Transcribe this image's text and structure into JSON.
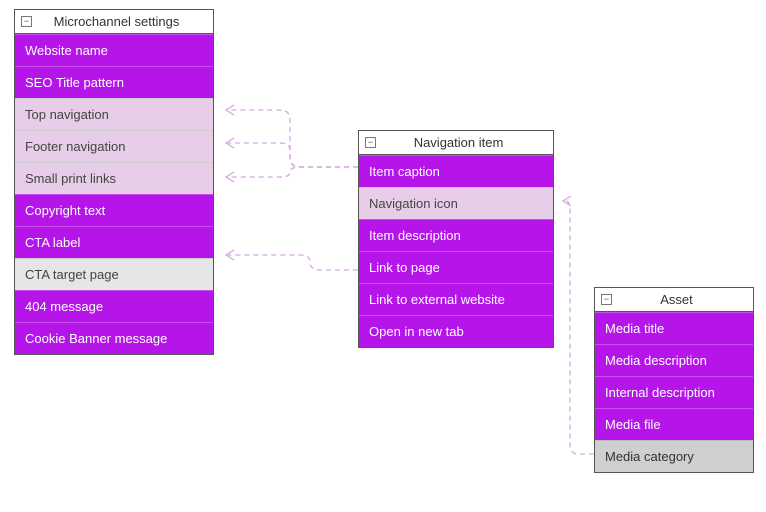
{
  "entities": {
    "microchannel": {
      "title": "Microchannel settings",
      "rows": [
        {
          "label": "Website name",
          "type": "normal"
        },
        {
          "label": "SEO Title pattern",
          "type": "normal"
        },
        {
          "label": "Top navigation",
          "type": "ref"
        },
        {
          "label": "Footer navigation",
          "type": "ref"
        },
        {
          "label": "Small print links",
          "type": "ref"
        },
        {
          "label": "Copyright text",
          "type": "normal"
        },
        {
          "label": "CTA label",
          "type": "normal"
        },
        {
          "label": "CTA target page",
          "type": "gray"
        },
        {
          "label": "404 message",
          "type": "normal"
        },
        {
          "label": "Cookie Banner message",
          "type": "normal"
        }
      ]
    },
    "navitem": {
      "title": "Navigation item",
      "rows": [
        {
          "label": "Item caption",
          "type": "normal"
        },
        {
          "label": "Navigation icon",
          "type": "ref"
        },
        {
          "label": "Item description",
          "type": "normal"
        },
        {
          "label": "Link to page",
          "type": "normal"
        },
        {
          "label": "Link to external website",
          "type": "normal"
        },
        {
          "label": "Open in new tab",
          "type": "normal"
        }
      ]
    },
    "asset": {
      "title": "Asset",
      "rows": [
        {
          "label": "Media title",
          "type": "normal"
        },
        {
          "label": "Media description",
          "type": "normal"
        },
        {
          "label": "Internal description",
          "type": "normal"
        },
        {
          "label": "Media file",
          "type": "normal"
        },
        {
          "label": "Media category",
          "type": "gray-dk"
        }
      ]
    }
  },
  "collapse_glyph": "−"
}
